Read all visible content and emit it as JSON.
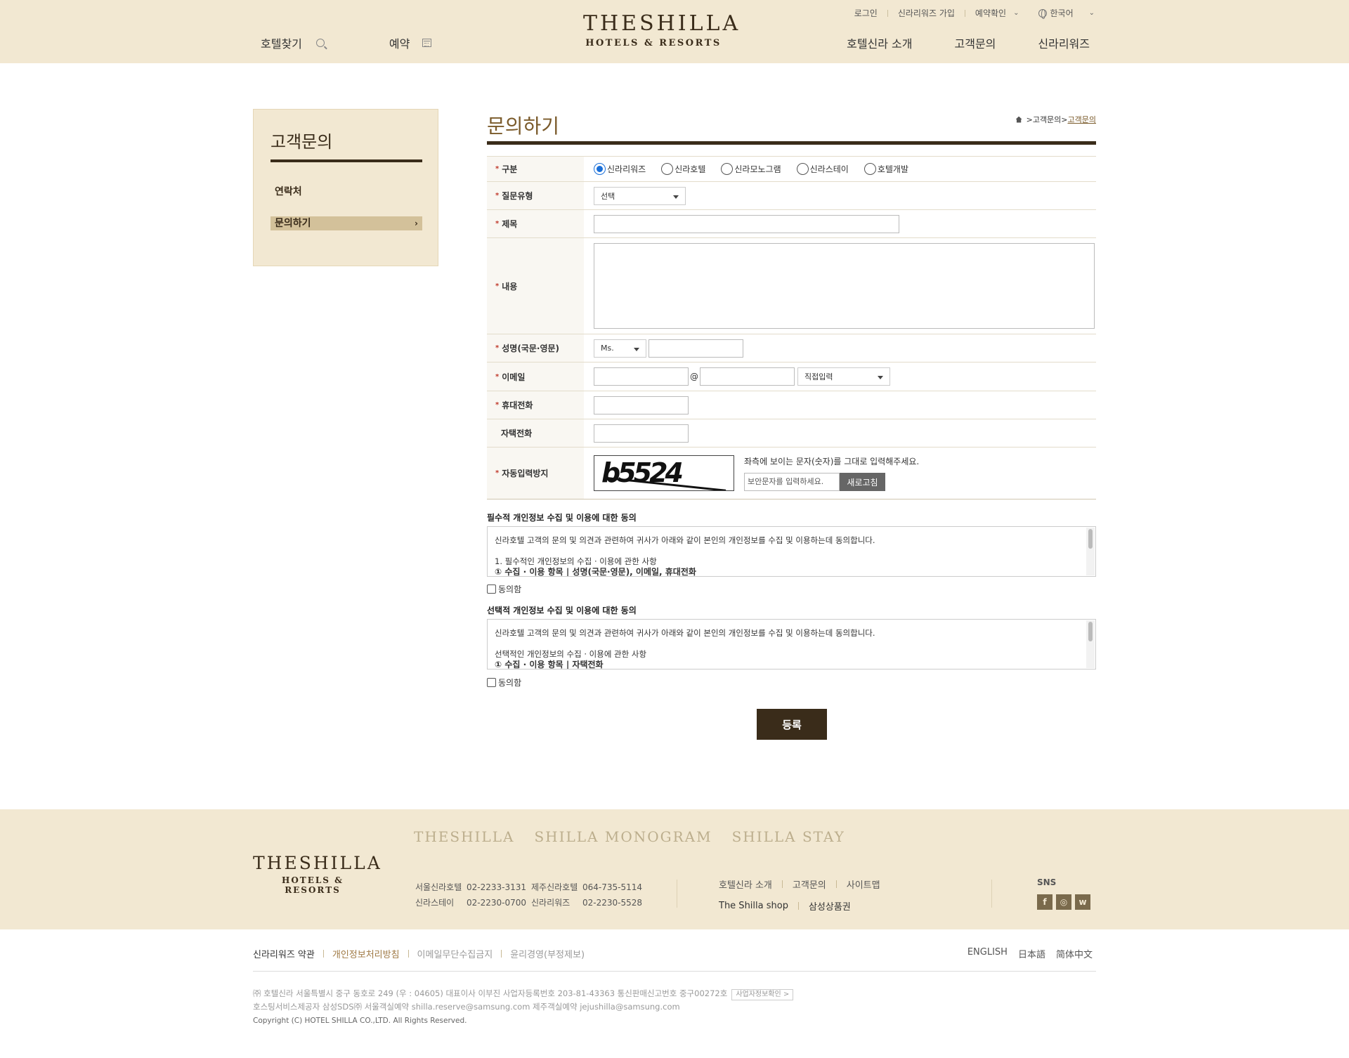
{
  "header": {
    "util": {
      "login": "로그인",
      "join": "신라리워즈 가입",
      "reserve_check": "예약확인",
      "language": "한국어"
    },
    "logo": {
      "line1": "THESHILLA",
      "line2": "HOTELS & RESORTS"
    },
    "left_nav": {
      "find_hotel": "호텔찾기",
      "reserve": "예약"
    },
    "right_nav": [
      "호텔신라 소개",
      "고객문의",
      "신라리워즈"
    ]
  },
  "sidebar": {
    "title": "고객문의",
    "items": [
      "연락처",
      "문의하기"
    ]
  },
  "content": {
    "title": "문의하기",
    "breadcrumb": {
      "sep1": " > ",
      "mid": "고객문의",
      "sep2": " > ",
      "current": "고객문의"
    }
  },
  "form": {
    "category": {
      "label": "구분",
      "options": [
        "신라리워즈",
        "신라호텔",
        "신라모노그램",
        "신라스테이",
        "호텔개발"
      ],
      "selected": 0
    },
    "question_type": {
      "label": "질문유형",
      "value": "선택"
    },
    "subject": {
      "label": "제목"
    },
    "body": {
      "label": "내용"
    },
    "name": {
      "label": "성명(국문·영문)",
      "title_value": "Ms."
    },
    "email": {
      "label": "이메일",
      "at": "@",
      "domain_select": "직접입력"
    },
    "mobile": {
      "label": "휴대전화"
    },
    "home_phone": {
      "label": "자택전화"
    },
    "captcha": {
      "label": "자동입력방지",
      "code": "b5524",
      "desc": "좌측에 보이는 문자(숫자)를 그대로 입력해주세요.",
      "placeholder": "보안문자를 입력하세요.",
      "refresh": "새로고침"
    }
  },
  "agree_required": {
    "title": "필수적 개인정보 수집 및 이용에 대한 동의",
    "line1": "신라호텔 고객의 문의 및 의견과 관련하여 귀사가 아래와 같이 본인의 개인정보를 수집 및 이용하는데 동의합니다.",
    "line2": "1. 필수적인 개인정보의 수집 · 이용에 관한 사항",
    "line3": "① 수집 · 이용 항목 | 성명(국문·영문), 이메일, 휴대전화",
    "check": "동의함"
  },
  "agree_optional": {
    "title": "선택적 개인정보 수집 및 이용에 대한 동의",
    "line1": "신라호텔 고객의 문의 및 의견과 관련하여 귀사가 아래와 같이 본인의 개인정보를 수집 및 이용하는데 동의합니다.",
    "line2": "선택적인 개인정보의 수집 · 이용에 관한 사항",
    "line3": "① 수집 · 이용 항목 | 자택전화",
    "check": "동의함"
  },
  "submit": "등록",
  "footer": {
    "brands": [
      "THESHILLA",
      "SHILLA MONOGRAM",
      "SHILLA STAY"
    ],
    "logo": {
      "line1": "THESHILLA",
      "line2": "HOTELS & RESORTS"
    },
    "phones": [
      {
        "name": "서울신라호텔",
        "value": "02-2233-3131",
        "name2": "제주신라호텔",
        "value2": "064-735-5114"
      },
      {
        "name": "신라스테이",
        "value": "02-2230-0700",
        "name2": "신라리워즈",
        "value2": "02-2230-5528"
      }
    ],
    "links_row1": [
      "호텔신라 소개",
      "고객문의",
      "사이트맵"
    ],
    "links_row2": [
      "The Shilla shop",
      "삼성상품권"
    ],
    "sns_label": "SNS",
    "sns": [
      "f",
      "◎",
      "w"
    ]
  },
  "bottom": {
    "links": [
      "신라리워즈 약관",
      "개인정보처리방침",
      "이메일무단수집금지",
      "윤리경영(부정제보)"
    ],
    "langs": [
      "ENGLISH",
      "日本語",
      "简体中文"
    ],
    "info1": "㈜ 호텔신라 서울특별시 중구 동호로 249 (우 : 04605)   대표이사 이부진   사업자등록번호 203-81-43363   통신판매신고번호 중구00272호",
    "badge": "사업자정보확인 >",
    "info2": "호스팅서비스제공자 삼성SDS㈜   서울객실예약 shilla.reserve@samsung.com   제주객실예약 jejushilla@samsung.com",
    "copyright": "Copyright (C) HOTEL SHILLA CO.,LTD. All Rights Reserved."
  }
}
